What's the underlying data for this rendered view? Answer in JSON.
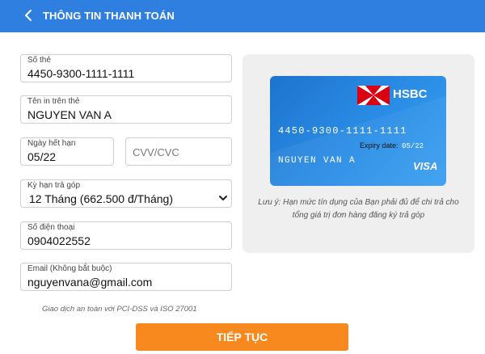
{
  "header": {
    "title": "THÔNG TIN THANH TOÁN",
    "back_icon": "chevron-left-icon"
  },
  "form": {
    "card_number": {
      "label": "Số thẻ",
      "value": "4450-9300-1111-1111"
    },
    "card_name": {
      "label": "Tên in trên thẻ",
      "value": "NGUYEN VAN A"
    },
    "expiry": {
      "label": "Ngày hết hạn",
      "value": "05/22"
    },
    "cvv": {
      "placeholder": "CVV/CVC"
    },
    "installment": {
      "label": "Kỳ hạn trả góp",
      "value": "12 Tháng (662.500 đ/Tháng)"
    },
    "phone": {
      "label": "Số điện thoại",
      "value": "0904022552"
    },
    "email": {
      "label": "Email (Không bắt buộc)",
      "value": "nguyenvana@gmail.com"
    }
  },
  "security_note": "Giao dịch an toàn với PCI-DSS và ISO 27001",
  "submit_label": "TIẾP TỤC",
  "card_preview": {
    "bank": "HSBC",
    "number": "4450-9300-1111-1111",
    "expiry_label": "Expiry date:",
    "expiry_value": "05/22",
    "name": "NGUYEN VAN A",
    "network": "VISA",
    "note": "Lưu ý: Hạn mức tín dụng của Bạn phải đủ để chi trả cho tổng giá trị đơn hàng đăng ký trả góp"
  },
  "colors": {
    "header": "#2f7fe0",
    "button": "#f7891f",
    "card": "#1d74cf",
    "hsbc_red": "#db0011"
  }
}
